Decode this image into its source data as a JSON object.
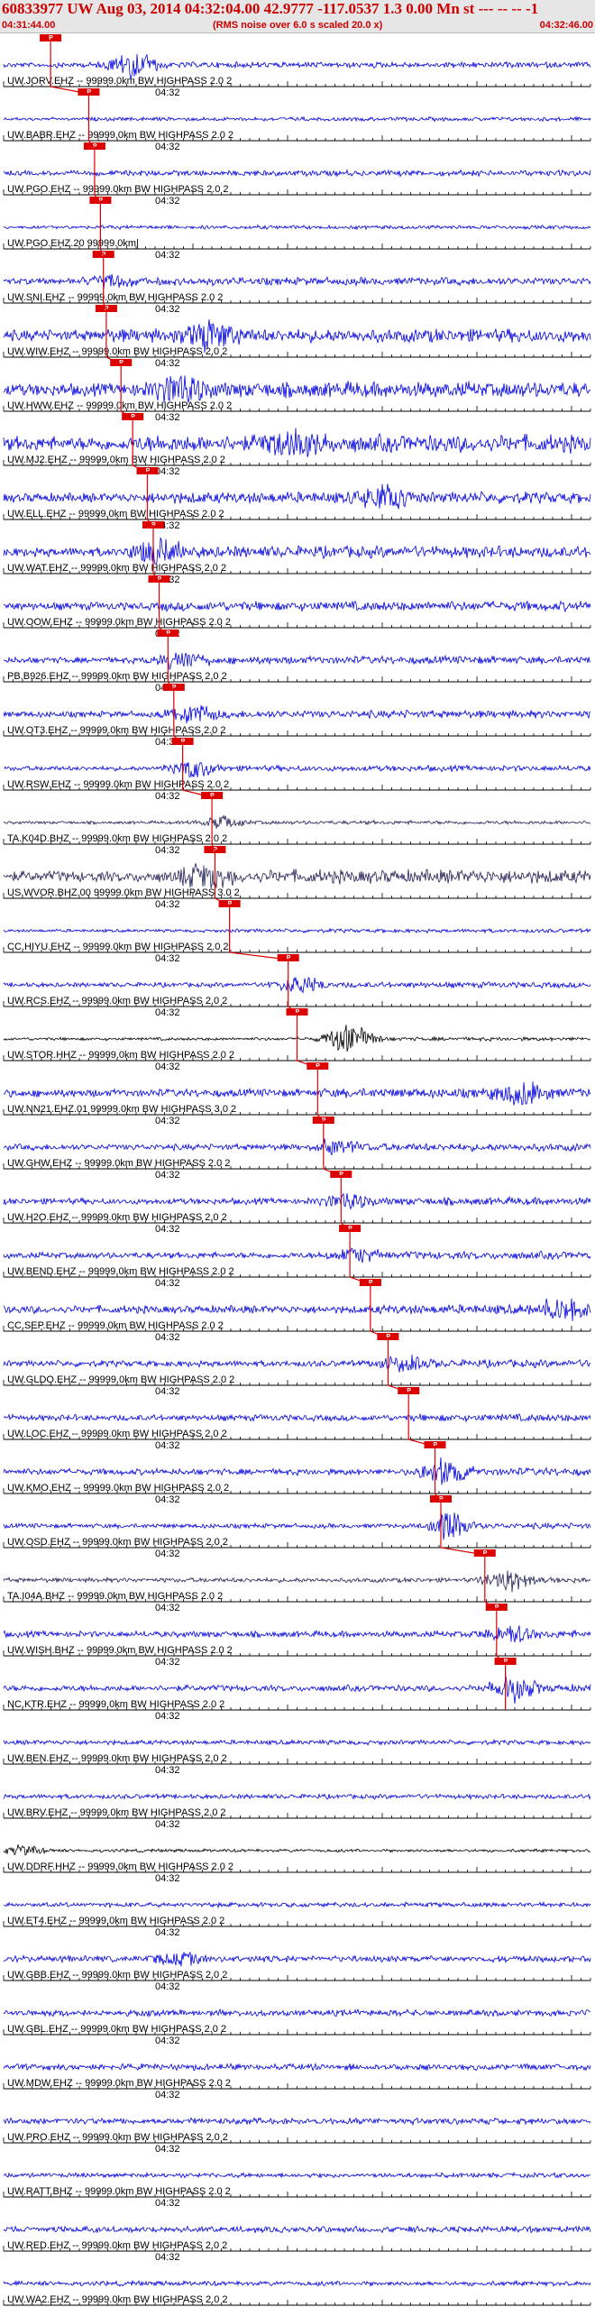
{
  "header": {
    "title": "60833977 UW Aug 03, 2014 04:32:04.00   42.9777 -117.0537  1.3 0.00 Mn st --- -- --  -1",
    "start_time": "04:31:44.00",
    "end_time": "04:32:46.00",
    "rms_note": "(RMS noise over 6.0 s scaled 20.0 x)"
  },
  "colors": {
    "trace_blue": "#0000dd",
    "trace_dark": "#222255",
    "trace_black": "#000000",
    "pick_red": "#dd0000"
  },
  "time_mark": "04:32",
  "pick_label": "P",
  "channels": [
    {
      "label": "UW.JORV.EHZ -- 99999.0km BW  HIGHPASS  2.0  2",
      "color": "blue",
      "amp": 3,
      "pick": 0.08,
      "burst": 0.22,
      "burst_amp": 14
    },
    {
      "label": "UW.BABR.EHZ -- 99999.0km BW  HIGHPASS  2.0  2",
      "color": "blue",
      "amp": 2,
      "pick": 0.145,
      "burst": 0,
      "burst_amp": 0
    },
    {
      "label": "UW.PGO.EHZ -- 99999.0km BW  HIGHPASS  2.0  2",
      "color": "blue",
      "amp": 3,
      "pick": 0.155,
      "burst": 0,
      "burst_amp": 0
    },
    {
      "label": "UW.PGO.EHZ.20 99999.0km|",
      "color": "blue",
      "amp": 2,
      "pick": 0.165,
      "burst": 0,
      "burst_amp": 0
    },
    {
      "label": "UW.SNI.EHZ -- 99999.0km BW  HIGHPASS  2.0  2",
      "color": "blue",
      "amp": 4,
      "pick": 0.17,
      "burst": 0.18,
      "burst_amp": 6
    },
    {
      "label": "UW.WIW.EHZ -- 99999.0km BW  HIGHPASS  2.0  2",
      "color": "blue",
      "amp": 7,
      "pick": 0.175,
      "burst": 0.35,
      "burst_amp": 14
    },
    {
      "label": "UW.HWW.EHZ -- 99999.0km BW  HIGHPASS  2.0  2",
      "color": "blue",
      "amp": 8,
      "pick": 0.2,
      "burst": 0.3,
      "burst_amp": 14
    },
    {
      "label": "UW.MJ2.EHZ -- 99999.0km BW  HIGHPASS  2.0  2",
      "color": "blue",
      "amp": 9,
      "pick": 0.22,
      "burst": 0.5,
      "burst_amp": 13
    },
    {
      "label": "UW.ELL.EHZ -- 99999.0km BW  HIGHPASS  2.0  2",
      "color": "blue",
      "amp": 6,
      "pick": 0.245,
      "burst": 0.65,
      "burst_amp": 11
    },
    {
      "label": "UW.WAT.EHZ -- 99999.0km BW  HIGHPASS  2.0  2",
      "color": "blue",
      "amp": 6,
      "pick": 0.255,
      "burst": 0.26,
      "burst_amp": 13
    },
    {
      "label": "UW.OOW.EHZ -- 99999.0km BW  HIGHPASS  2.0  2",
      "color": "blue",
      "amp": 5,
      "pick": 0.265,
      "burst": 0,
      "burst_amp": 0
    },
    {
      "label": "PB.B926.EHZ -- 99999.0km BW  HIGHPASS  2.0  2",
      "color": "blue",
      "amp": 4,
      "pick": 0.28,
      "burst": 0.3,
      "burst_amp": 9
    },
    {
      "label": "UW.OT3.EHZ -- 99999.0km BW  HIGHPASS  2.0  2",
      "color": "blue",
      "amp": 4,
      "pick": 0.29,
      "burst": 0.32,
      "burst_amp": 10
    },
    {
      "label": "UW.RSW.EHZ -- 99999.0km BW  HIGHPASS  2.0  2",
      "color": "blue",
      "amp": 3,
      "pick": 0.305,
      "burst": 0.32,
      "burst_amp": 9
    },
    {
      "label": "TA.K04D.BHZ -- 99999.0km BW  HIGHPASS  2.0  2",
      "color": "dark",
      "amp": 2,
      "pick": 0.355,
      "burst": 0.37,
      "burst_amp": 6
    },
    {
      "label": "US.WVOR.BHZ.00 99999.0km BW  HIGHPASS  3.0  2",
      "color": "dark",
      "amp": 7,
      "pick": 0.36,
      "burst": 0.34,
      "burst_amp": 14
    },
    {
      "label": "CC.HIYU.EHZ -- 99999.0km BW  HIGHPASS  2.0  2",
      "color": "blue",
      "amp": 2,
      "pick": 0.385,
      "burst": 0,
      "burst_amp": 0
    },
    {
      "label": "UW.RCS.EHZ -- 99999.0km BW  HIGHPASS  2.0  2",
      "color": "blue",
      "amp": 3,
      "pick": 0.485,
      "burst": 0.5,
      "burst_amp": 9
    },
    {
      "label": "UW.STOR.HHZ -- 99999.0km BW  HIGHPASS  2.0  2",
      "color": "black",
      "amp": 2,
      "pick": 0.5,
      "burst": 0.59,
      "burst_amp": 15
    },
    {
      "label": "UW.NN21.EHZ.01 99999.0km BW  HIGHPASS  3.0  2",
      "color": "blue",
      "amp": 5,
      "pick": 0.535,
      "burst": 0.88,
      "burst_amp": 12
    },
    {
      "label": "UW.GHW.EHZ -- 99999.0km BW  HIGHPASS  2.0  2",
      "color": "blue",
      "amp": 4,
      "pick": 0.545,
      "burst": 0.57,
      "burst_amp": 7
    },
    {
      "label": "UW.H2O.EHZ -- 99999.0km BW  HIGHPASS  2.0  2",
      "color": "blue",
      "amp": 4,
      "pick": 0.575,
      "burst": 0.58,
      "burst_amp": 8
    },
    {
      "label": "UW.BEND.EHZ -- 99999.0km BW  HIGHPASS  2.0  2",
      "color": "blue",
      "amp": 4,
      "pick": 0.59,
      "burst": 0.6,
      "burst_amp": 7
    },
    {
      "label": "CC.SEP.EHZ -- 99999.0km BW  HIGHPASS  2.0  2",
      "color": "blue",
      "amp": 5,
      "pick": 0.625,
      "burst": 0.95,
      "burst_amp": 10
    },
    {
      "label": "UW.GLDO.EHZ -- 99999.0km BW  HIGHPASS  2.0  2",
      "color": "blue",
      "amp": 4,
      "pick": 0.655,
      "burst": 0.68,
      "burst_amp": 7
    },
    {
      "label": "UW.LOC.EHZ -- 99999.0km BW  HIGHPASS  2.0  2",
      "color": "blue",
      "amp": 4,
      "pick": 0.69,
      "burst": 0,
      "burst_amp": 0
    },
    {
      "label": "UW.KMO.EHZ -- 99999.0km BW  HIGHPASS  2.0  2",
      "color": "blue",
      "amp": 4,
      "pick": 0.735,
      "burst": 0.75,
      "burst_amp": 14
    },
    {
      "label": "UW.OSD.EHZ -- 99999.0km BW  HIGHPASS  2.0  2",
      "color": "blue",
      "amp": 3,
      "pick": 0.745,
      "burst": 0.76,
      "burst_amp": 14
    },
    {
      "label": "TA.I04A.BHZ -- 99999.0km BW  HIGHPASS  2.0  2",
      "color": "dark",
      "amp": 3,
      "pick": 0.82,
      "burst": 0.86,
      "burst_amp": 11
    },
    {
      "label": "UW.WISH.BHZ -- 99999.0km BW  HIGHPASS  2.0  2",
      "color": "blue",
      "amp": 4,
      "pick": 0.84,
      "burst": 0.86,
      "burst_amp": 9
    },
    {
      "label": "NC.KTR.EHZ -- 99999.0km BW  HIGHPASS  2.0  2",
      "color": "blue",
      "amp": 4,
      "pick": 0.855,
      "burst": 0.87,
      "burst_amp": 12
    },
    {
      "label": "UW.BEN.EHZ -- 99999.0km BW  HIGHPASS  2.0  2",
      "color": "blue",
      "amp": 3,
      "pick": 0,
      "burst": 0,
      "burst_amp": 0
    },
    {
      "label": "UW.BRV.EHZ -- 99999.0km BW  HIGHPASS  2.0  2",
      "color": "blue",
      "amp": 3,
      "pick": 0,
      "burst": 0,
      "burst_amp": 0
    },
    {
      "label": "UW.DDRF.HHZ -- 99999.0km BW  HIGHPASS  2.0  2",
      "color": "black",
      "amp": 2,
      "pick": 0,
      "burst": 0.03,
      "burst_amp": 6
    },
    {
      "label": "UW.ET4.EHZ -- 99999.0km BW  HIGHPASS  2.0  2",
      "color": "blue",
      "amp": 3,
      "pick": 0,
      "burst": 0,
      "burst_amp": 0
    },
    {
      "label": "UW.GBB.EHZ -- 99999.0km BW  HIGHPASS  2.0  2",
      "color": "blue",
      "amp": 4,
      "pick": 0,
      "burst": 0.3,
      "burst_amp": 7
    },
    {
      "label": "UW.GBL.EHZ -- 99999.0km BW  HIGHPASS  2.0  2",
      "color": "blue",
      "amp": 4,
      "pick": 0,
      "burst": 0,
      "burst_amp": 0
    },
    {
      "label": "UW.MDW.EHZ -- 99999.0km BW  HIGHPASS  2.0  2",
      "color": "blue",
      "amp": 4,
      "pick": 0,
      "burst": 0,
      "burst_amp": 0
    },
    {
      "label": "UW.PRO.EHZ -- 99999.0km BW  HIGHPASS  2.0  2",
      "color": "blue",
      "amp": 4,
      "pick": 0,
      "burst": 0,
      "burst_amp": 0
    },
    {
      "label": "UW.RATT.BHZ -- 99999.0km BW  HIGHPASS  2.0  2",
      "color": "blue",
      "amp": 3,
      "pick": 0,
      "burst": 0,
      "burst_amp": 0
    },
    {
      "label": "UW.RED.EHZ -- 99999.0km BW  HIGHPASS  2.0  2",
      "color": "blue",
      "amp": 4,
      "pick": 0,
      "burst": 0,
      "burst_amp": 0
    },
    {
      "label": "UW.WA2.EHZ -- 99999.0km BW  HIGHPASS  2.0  2",
      "color": "blue",
      "amp": 3,
      "pick": 0,
      "burst": 0,
      "burst_amp": 0
    }
  ]
}
